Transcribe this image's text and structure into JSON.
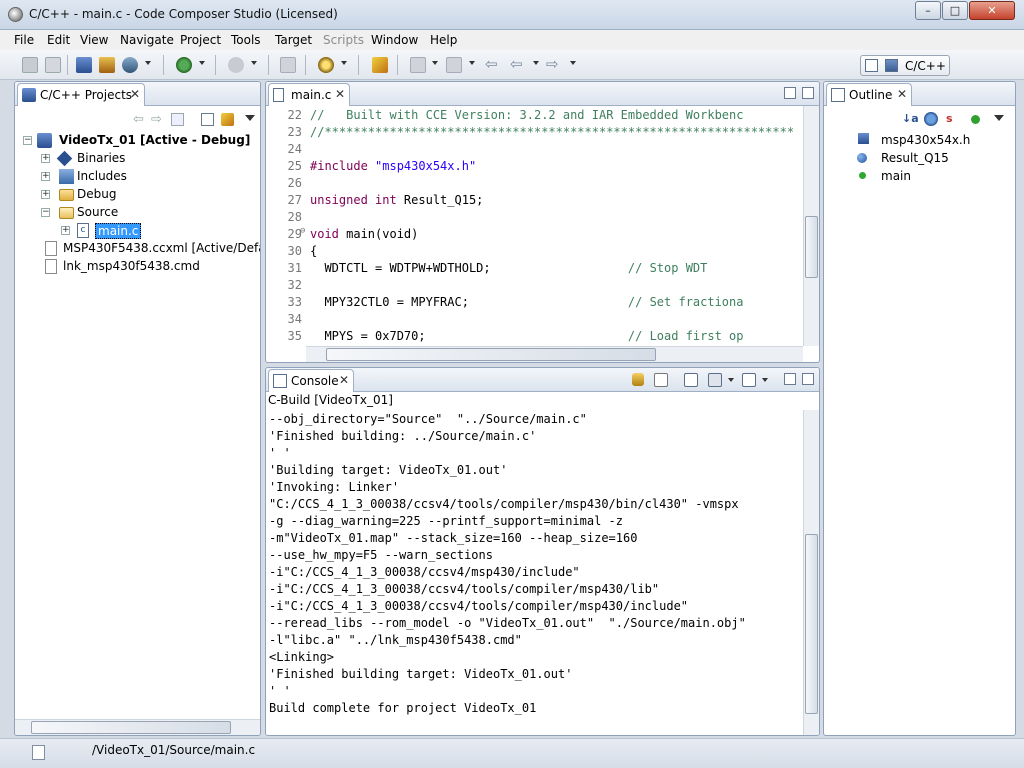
{
  "window": {
    "title": "C/C++ - main.c - Code Composer Studio (Licensed)",
    "minimize": "–",
    "maximize": "□",
    "close": "✕"
  },
  "menu": [
    "File",
    "Edit",
    "View",
    "Navigate",
    "Project",
    "Tools",
    "Target",
    "Scripts",
    "Window",
    "Help"
  ],
  "perspective": {
    "label": "C/C++"
  },
  "projects": {
    "tab_label": "C/C++ Projects",
    "tree": [
      {
        "label": "VideoTx_01  [Active - Debug]",
        "icon": "project-icon"
      },
      {
        "label": "Binaries",
        "icon": "binaries-icon"
      },
      {
        "label": "Includes",
        "icon": "includes-icon"
      },
      {
        "label": "Debug",
        "icon": "folder-icon"
      },
      {
        "label": "Source",
        "icon": "folder-open-icon"
      },
      {
        "label": "main.c",
        "icon": "c-file-icon"
      },
      {
        "label": "MSP430F5438.ccxml [Active/Defau",
        "icon": "ccxml-file-icon"
      },
      {
        "label": "lnk_msp430f5438.cmd",
        "icon": "cmd-file-icon"
      }
    ]
  },
  "editor": {
    "tab_label": "main.c",
    "lines": [
      {
        "num": "22",
        "text": "//   Built with CCE Version: 3.2.2 and IAR Embedded Workbenc",
        "color": "#3f7f5f"
      },
      {
        "num": "23",
        "text": "//*****************************************************************",
        "color": "#3f7f5f"
      },
      {
        "num": "24",
        "text": "",
        "color": "#000000"
      },
      {
        "num": "25",
        "text": "#include \"msp430x54x.h\"",
        "color": "#7f0055"
      },
      {
        "num": "26",
        "text": "",
        "color": "#000000"
      },
      {
        "num": "27",
        "text": "unsigned int Result_Q15;",
        "color": "#000000"
      },
      {
        "num": "28",
        "text": "",
        "color": "#000000"
      },
      {
        "num": "29",
        "text": "void main(void)",
        "color": "#000000"
      },
      {
        "num": "30",
        "text": "{",
        "color": "#000000"
      },
      {
        "num": "31",
        "text": "  WDTCTL = WDTPW+WDTHOLD;                   // Stop WDT",
        "color": "#000000"
      },
      {
        "num": "32",
        "text": "",
        "color": "#000000"
      },
      {
        "num": "33",
        "text": "  MPY32CTL0 = MPYFRAC;                      // Set fractiona",
        "color": "#000000"
      },
      {
        "num": "34",
        "text": "",
        "color": "#000000"
      },
      {
        "num": "35",
        "text": "  MPYS = 0x7D70;                            // Load first op",
        "color": "#000000"
      }
    ]
  },
  "console": {
    "tab_label": "Console",
    "title": "C-Build [VideoTx_01]",
    "lines": [
      "--obj_directory=\"Source\"  \"../Source/main.c\"",
      "'Finished building: ../Source/main.c'",
      "' '",
      "'Building target: VideoTx_01.out'",
      "'Invoking: Linker'",
      "\"C:/CCS_4_1_3_00038/ccsv4/tools/compiler/msp430/bin/cl430\" -vmspx",
      "-g --diag_warning=225 --printf_support=minimal -z",
      "-m\"VideoTx_01.map\" --stack_size=160 --heap_size=160",
      "--use_hw_mpy=F5 --warn_sections",
      "-i\"C:/CCS_4_1_3_00038/ccsv4/msp430/include\"",
      "-i\"C:/CCS_4_1_3_00038/ccsv4/tools/compiler/msp430/lib\"",
      "-i\"C:/CCS_4_1_3_00038/ccsv4/tools/compiler/msp430/include\"",
      "--reread_libs --rom_model -o \"VideoTx_01.out\"  \"./Source/main.obj\"",
      "-l\"libc.a\" \"../lnk_msp430f5438.cmd\"",
      "<Linking>",
      "'Finished building target: VideoTx_01.out'",
      "' '",
      "Build complete for project VideoTx_01"
    ]
  },
  "outline": {
    "tab_label": "Outline",
    "items": [
      {
        "label": "msp430x54x.h",
        "icon": "include-icon"
      },
      {
        "label": "Result_Q15",
        "icon": "variable-icon"
      },
      {
        "label": "main",
        "icon": "function-icon"
      }
    ]
  },
  "status": {
    "path": "/VideoTx_01/Source/main.c"
  }
}
